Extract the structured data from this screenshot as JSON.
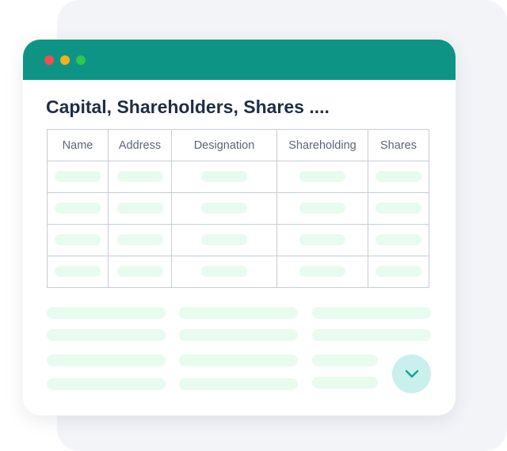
{
  "colors": {
    "titlebar": "#0e9484",
    "dot_red": "#f24e4e",
    "dot_yellow": "#f5b018",
    "dot_green": "#30c64a",
    "placeholder": "#e7fbef",
    "button_bg": "#c9f0ec",
    "button_icon": "#14a291"
  },
  "window": {
    "title": "Capital, Shareholders, Shares ...."
  },
  "table": {
    "columns": [
      "Name",
      "Address",
      "Designation",
      "Shareholding",
      "Shares"
    ],
    "row_count": 4
  },
  "expand_button": {
    "icon": "chevron-down-icon"
  }
}
